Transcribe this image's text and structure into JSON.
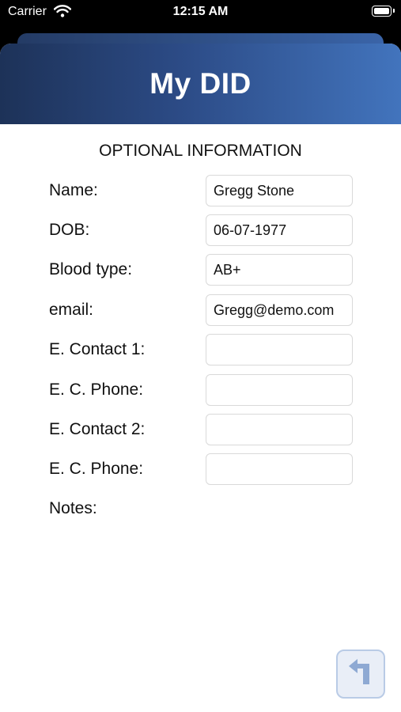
{
  "status_bar": {
    "carrier": "Carrier",
    "time": "12:15 AM"
  },
  "header": {
    "title": "My DID"
  },
  "section_title": "OPTIONAL INFORMATION",
  "fields": [
    {
      "label": "Name:",
      "value": "Gregg Stone"
    },
    {
      "label": "DOB:",
      "value": "06-07-1977"
    },
    {
      "label": "Blood type:",
      "value": "AB+"
    },
    {
      "label": "email:",
      "value": "Gregg@demo.com"
    },
    {
      "label": "E. Contact 1:",
      "value": ""
    },
    {
      "label": "E. C. Phone:",
      "value": ""
    },
    {
      "label": "E. Contact 2:",
      "value": ""
    },
    {
      "label": "E. C. Phone:",
      "value": ""
    }
  ],
  "notes_label": "Notes:",
  "back_button": {
    "icon": "return-arrow-icon"
  },
  "colors": {
    "header_start": "#1d3258",
    "header_end": "#4274bd",
    "button_bg": "#e9eef7",
    "button_icon": "#8ea9d3"
  }
}
